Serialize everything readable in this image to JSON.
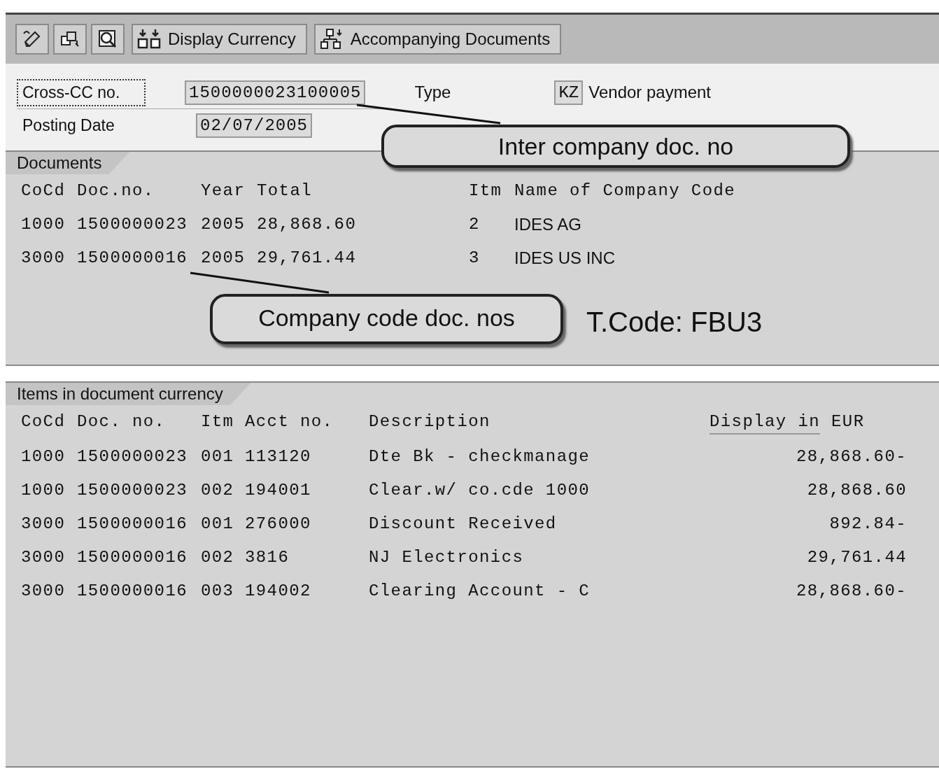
{
  "toolbar": {
    "buttons": [
      {
        "kind": "edit"
      },
      {
        "kind": "switch"
      },
      {
        "kind": "overview"
      },
      {
        "kind": "currency",
        "label": "Display Currency"
      },
      {
        "kind": "documents",
        "label": "Accompanying Documents"
      }
    ]
  },
  "header": {
    "cross_cc": {
      "label": "Cross-CC no.",
      "focused": true,
      "value": "1500000023100005"
    },
    "type": {
      "label": "Type",
      "code": "KZ",
      "text": "Vendor payment"
    },
    "posting_date": {
      "label": "Posting Date",
      "value": "02/07/2005"
    }
  },
  "documents": {
    "title": "Documents",
    "columns": [
      "CoCd",
      "Doc.no.",
      "Year",
      "Total",
      "Itm",
      "Name of Company Code"
    ],
    "rows": [
      [
        "1000",
        "1500000023",
        "2005",
        "28,868.60",
        "2",
        "IDES AG"
      ],
      [
        "3000",
        "1500000016",
        "2005",
        "29,761.44",
        "3",
        "IDES US INC"
      ]
    ]
  },
  "items": {
    "title": "Items in document currency",
    "columns": [
      "CoCd",
      "Doc. no.",
      "Itm",
      "Acct no.",
      "Description"
    ],
    "display_in": "Display in",
    "currency": "EUR",
    "rows": [
      [
        "1000",
        "1500000023",
        "001",
        "113120",
        "Dte Bk - checkmanage",
        "28,868.60-"
      ],
      [
        "1000",
        "1500000023",
        "002",
        "194001",
        "Clear.w/ co.cde 1000",
        "28,868.60"
      ],
      [
        "3000",
        "1500000016",
        "001",
        "276000",
        "Discount Received",
        "892.84-"
      ],
      [
        "3000",
        "1500000016",
        "002",
        "3816",
        "NJ Electronics",
        "29,761.44"
      ],
      [
        "3000",
        "1500000016",
        "003",
        "194002",
        "Clearing Account - C",
        "28,868.60-"
      ]
    ]
  },
  "annotations": {
    "callouts": [
      "Inter company doc. no",
      "Company code doc. nos"
    ],
    "tcode": "T.Code: FBU3"
  }
}
